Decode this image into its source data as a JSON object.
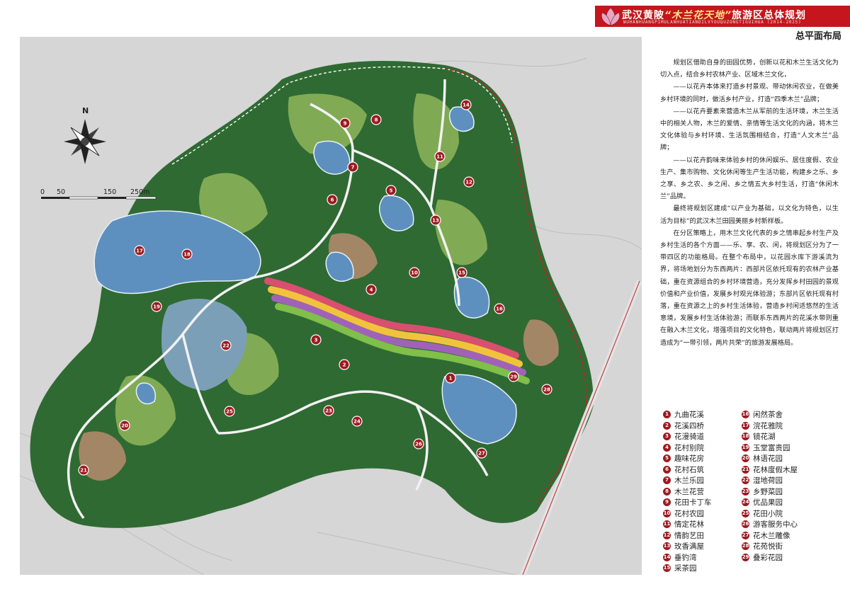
{
  "header": {
    "title_prefix": "武汉黄陂",
    "title_highlight": "“木兰花天地”",
    "title_suffix": "旅游区总体规划",
    "subtitle_pinyin": "WUHANHUANGPIMULANHUATIANDILVYOUQUZONGTIGUIHUA (2014-2025)",
    "page_title": "总平面布局"
  },
  "map": {
    "north_label": "N",
    "scale_labels": [
      "0",
      "50",
      "150",
      "250m"
    ],
    "colors": {
      "water": "#5d90bf",
      "forest": "#2f6a33",
      "road_red": "#c02428",
      "marker": "#9b1b20"
    }
  },
  "description": [
    "规划区借助自身的田园优势，创新以花和木兰生活文化为切入点，结合乡村农林产业、区域木兰文化，",
    "——以花卉本体来打造乡村景观、带动休闲农业，在做美乡村环境的同时，做活乡村产业，打造“四季木兰”品牌；",
    "——以花卉要素来营造木兰从军前的生活环境，木兰生活中的相关人物，木兰的爱情、亲情等生活文化的内涵，将木兰文化体验与乡村环境、生活氛围相结合，打造“人文木兰”品牌；",
    "——以花卉韵味来体验乡村的休闲娱乐、居住度假、农业生产、集市购物、文化休闲等生产生活功能，构建乡之乐、乡之享、乡之农、乡之闲、乡之情五大乡村生活，打造“休闲木兰”品牌。",
    "最终将规划区建成“以产业为基础，以文化为特色，以生活为目标”的武汉木兰田园美丽乡村新样板。",
    "在分区策略上，用木兰文化代表的乡之情串起乡村生产及乡村生活的各个方面——乐、享、农、闲，将规划区分为了一带四区的功能格局。在整个布局中，以花园水库下游溪流为界，将场地划分为东西两片：西部片区依托现有的农林产业基础，重在资源组合的乡村环境营造，充分发挥乡村田园的景观价值和产业价值，发展乡村观光体验游；东部片区依托现有村落，重在资源之上的乡村生活体验，营造乡村闲适悠然的生活意境，发展乡村生活体验游；而联系东西两片的花溪水带则重在融入木兰文化，增强项目的文化特色，联动两片将规划区打造成为“一带引领，两片共荣”的旅游发展格局。"
  ],
  "legend": [
    {
      "num": "1",
      "label": "九曲花溪"
    },
    {
      "num": "2",
      "label": "花溪四桥"
    },
    {
      "num": "3",
      "label": "花漫骑道"
    },
    {
      "num": "4",
      "label": "花村别院"
    },
    {
      "num": "5",
      "label": "趣味花房"
    },
    {
      "num": "6",
      "label": "花村石筑"
    },
    {
      "num": "7",
      "label": "木兰乐园"
    },
    {
      "num": "8",
      "label": "木兰花营"
    },
    {
      "num": "9",
      "label": "花田卡丁车"
    },
    {
      "num": "10",
      "label": "花村农园"
    },
    {
      "num": "11",
      "label": "情定花林"
    },
    {
      "num": "12",
      "label": "情韵艺田"
    },
    {
      "num": "13",
      "label": "玫香满屋"
    },
    {
      "num": "14",
      "label": "垂钓湾"
    },
    {
      "num": "15",
      "label": "采茶园"
    },
    {
      "num": "16",
      "label": "闲然茶舍"
    },
    {
      "num": "17",
      "label": "浣花雅院"
    },
    {
      "num": "18",
      "label": "镜花湖"
    },
    {
      "num": "19",
      "label": "玉堂富贵园"
    },
    {
      "num": "20",
      "label": "林语花园"
    },
    {
      "num": "21",
      "label": "花林度假木屋"
    },
    {
      "num": "22",
      "label": "湿地荷园"
    },
    {
      "num": "23",
      "label": "乡野菜园"
    },
    {
      "num": "24",
      "label": "优品果园"
    },
    {
      "num": "25",
      "label": "花田小院"
    },
    {
      "num": "26",
      "label": "游客服务中心"
    },
    {
      "num": "27",
      "label": "花木兰雕像"
    },
    {
      "num": "28",
      "label": "花苑悦街"
    },
    {
      "num": "29",
      "label": "叠彩花园"
    }
  ]
}
